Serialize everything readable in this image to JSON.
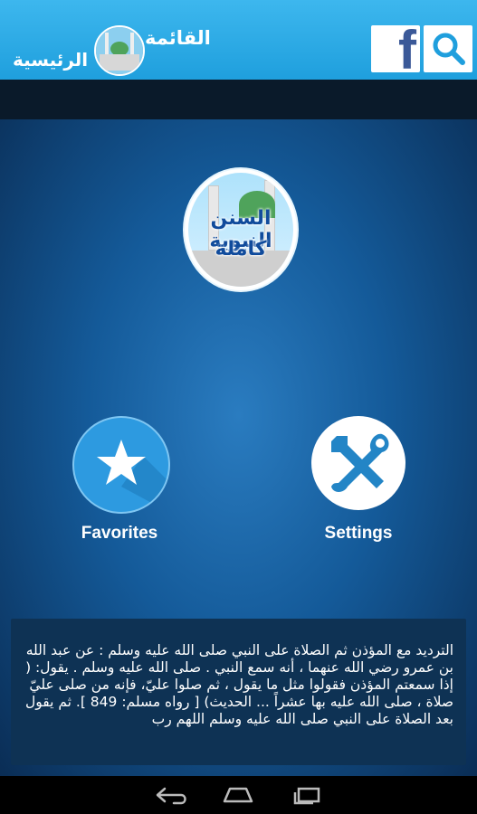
{
  "header": {
    "title_line1": "القائمة",
    "title_line2": "الرئيسية",
    "facebook_icon": "facebook-icon",
    "search_icon": "search-icon"
  },
  "logo": {
    "line1": "السنن النبوية",
    "line2": "كاملة"
  },
  "buttons": {
    "favorites_label": "Favorites",
    "settings_label": "Settings"
  },
  "daily_text": "الترديد مع المؤذن ثم الصلاة على النبي صلى الله عليه وسلم : عن عبد الله بن عمرو رضي الله عنهما ، أنه سمع النبي . صلى الله عليه وسلم . يقول: ( إذا سمعتم المؤذن فقولوا مثل ما يقول ، ثم صلوا عليّ، فإنه من صلى عليّ صلاة ، صلى الله عليه بها عشراً ... الحديث) [ رواه مسلم: 849 ]. ثم يقول بعد الصلاة على النبي صلى الله عليه وسلم اللهم رب",
  "nav": {
    "back_icon": "back-icon",
    "home_icon": "home-icon",
    "recents_icon": "recents-icon"
  },
  "colors": {
    "topbar": "#28a8e6",
    "main_bg": "#145a99",
    "favorites_circle": "#2d9ae0",
    "text_panel": "#0e3254"
  }
}
